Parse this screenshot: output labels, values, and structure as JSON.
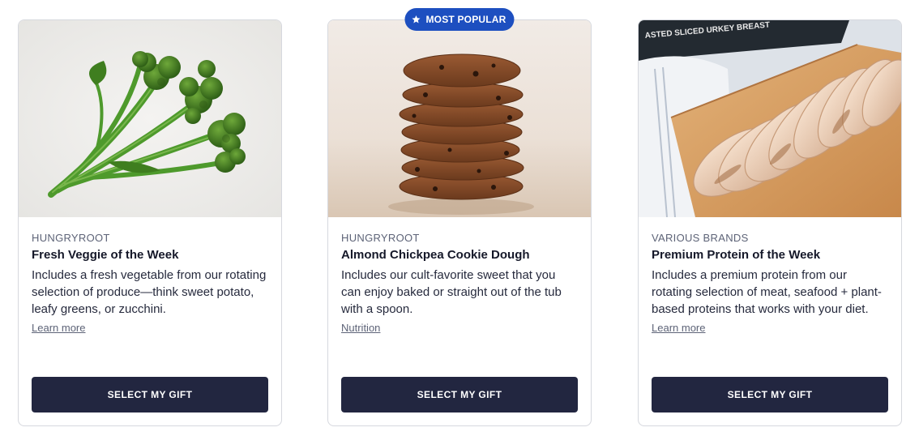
{
  "cards": [
    {
      "brand": "HUNGRYROOT",
      "title": "Fresh Veggie of the Week",
      "description": "Includes a fresh vegetable from our rotating selection of produce—think sweet potato, leafy greens, or zucchini.",
      "link": "Learn more",
      "button": "SELECT MY GIFT",
      "image_icon": "broccolini-image"
    },
    {
      "badge": "MOST POPULAR",
      "badge_icon": "star-icon",
      "brand": "HUNGRYROOT",
      "title": "Almond Chickpea Cookie Dough",
      "description": "Includes our cult-favorite sweet that you can enjoy baked or straight out of the tub with a spoon.",
      "link": "Nutrition",
      "button": "SELECT MY GIFT",
      "image_icon": "cookie-stack-image"
    },
    {
      "brand": "VARIOUS BRANDS",
      "title": "Premium Protein of the Week",
      "description": "Includes a premium protein from our rotating selection of meat, seafood + plant-based proteins that works with your diet.",
      "link": "Learn more",
      "button": "SELECT MY GIFT",
      "image_icon": "sliced-turkey-image",
      "image_text": "ASTED SLICED URKEY BREAST"
    }
  ],
  "colors": {
    "button_bg": "#222640",
    "badge_bg": "#1d4fc0",
    "border": "#d6d8de"
  }
}
